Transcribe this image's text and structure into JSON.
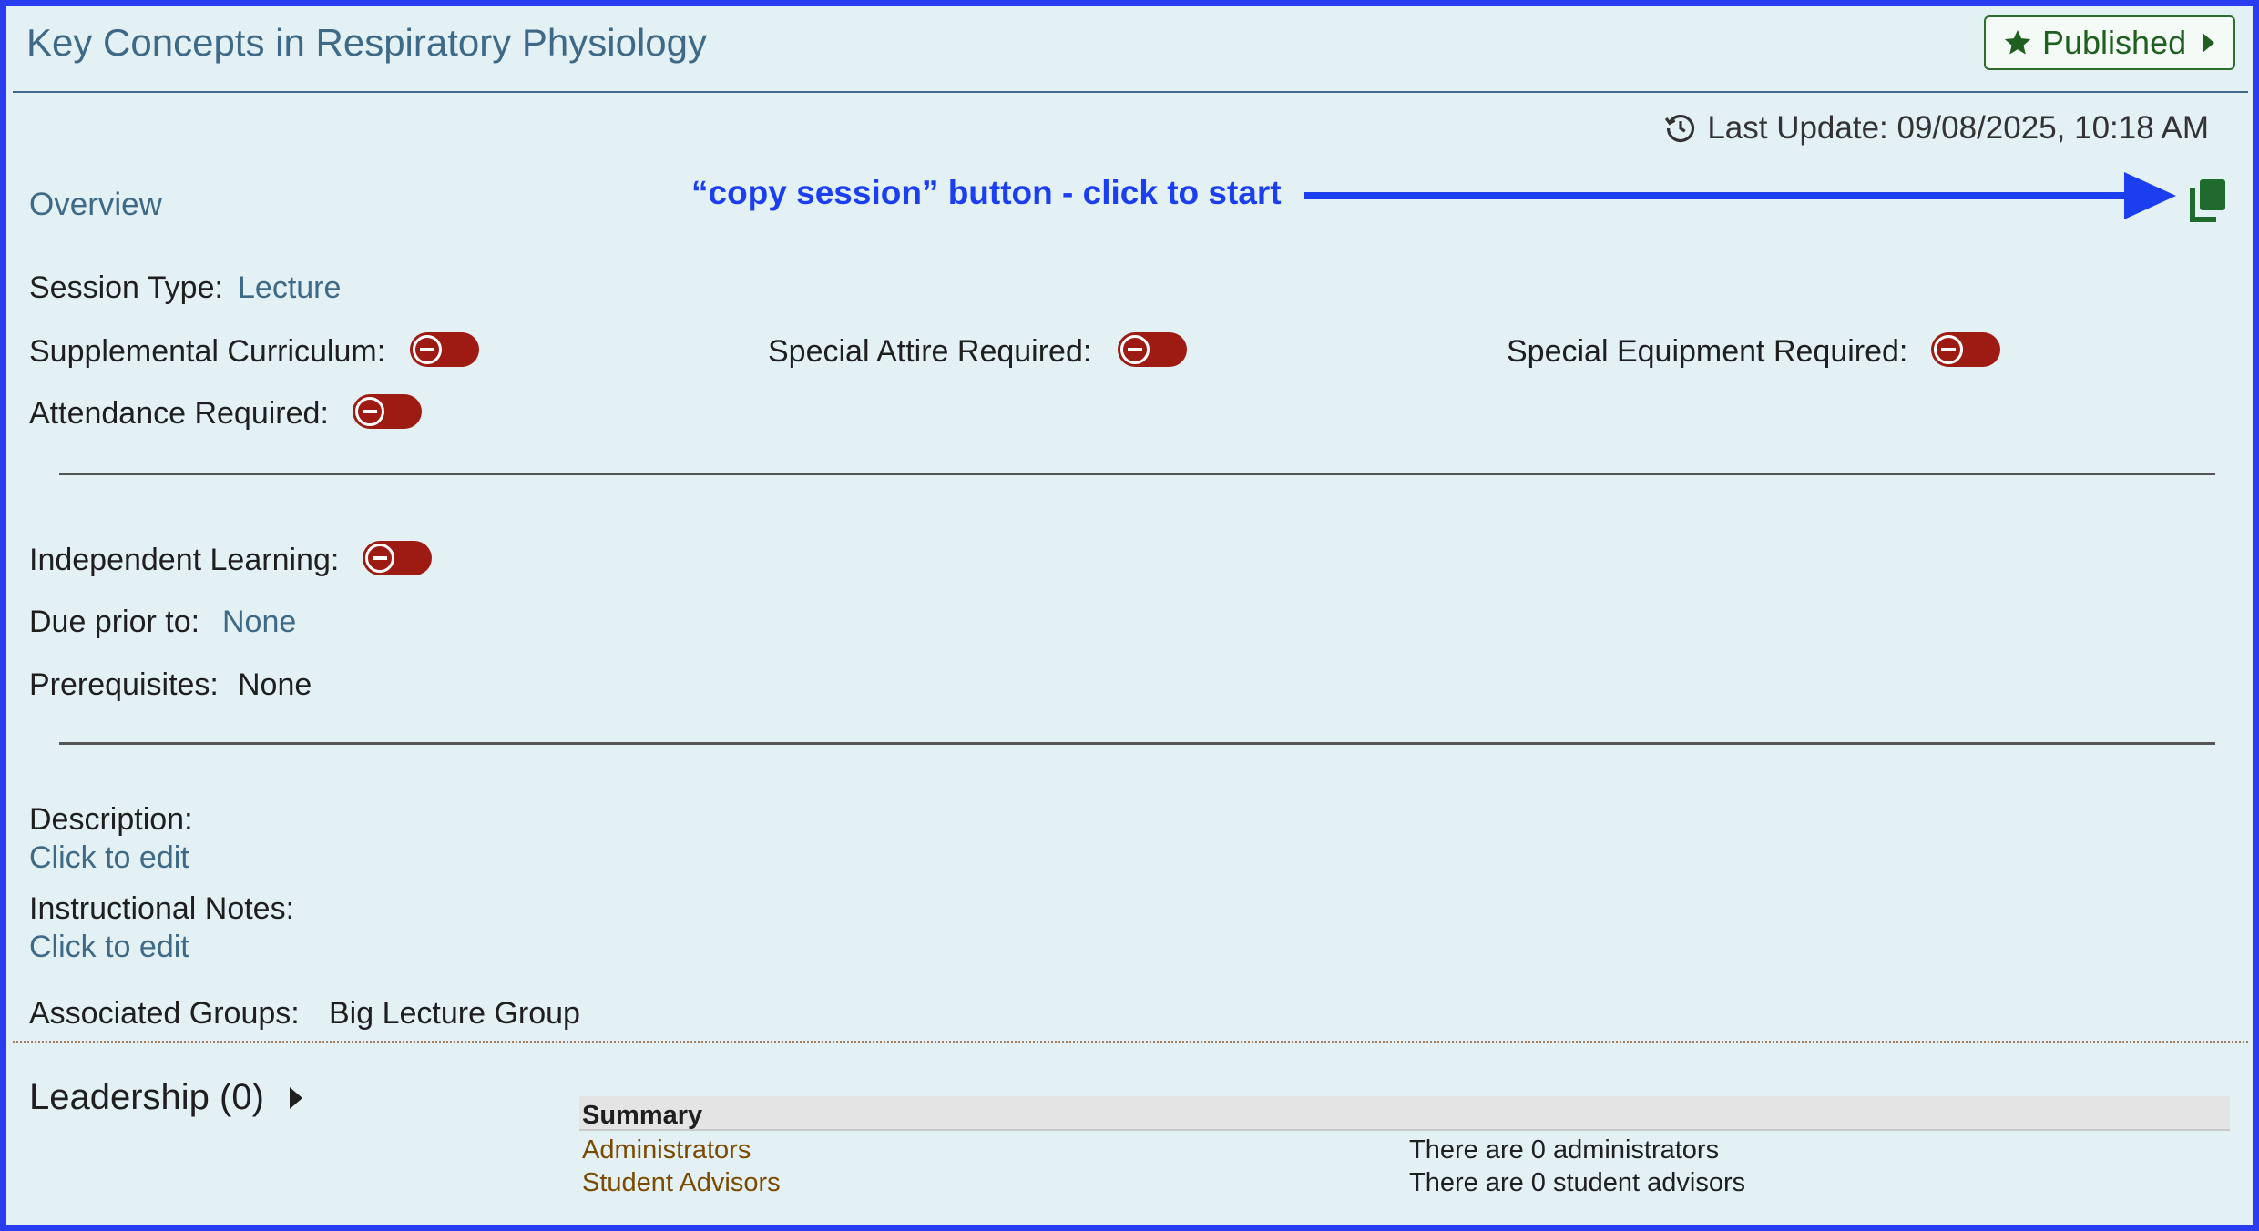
{
  "header": {
    "title": "Key Concepts in Respiratory Physiology",
    "status_button": "Published"
  },
  "meta": {
    "last_update": "Last Update: 09/08/2025, 10:18 AM"
  },
  "overview_label": "Overview",
  "annotation": {
    "text": "“copy session” button - click to start",
    "color": "#1b3ff0"
  },
  "fields": {
    "session_type_label": "Session Type:",
    "session_type_value": "Lecture",
    "supplemental_label": "Supplemental Curriculum:",
    "special_attire_label": "Special Attire Required:",
    "special_equipment_label": "Special Equipment Required:",
    "attendance_label": "Attendance Required:",
    "independent_label": "Independent Learning:",
    "due_prior_label": "Due prior to:",
    "due_prior_value": "None",
    "prereq_label": "Prerequisites:",
    "prereq_value": "None",
    "description_label": "Description:",
    "description_value": "Click to edit",
    "notes_label": "Instructional Notes:",
    "notes_value": "Click to edit",
    "groups_label": "Associated Groups:",
    "groups_value": "Big Lecture Group"
  },
  "toggles": {
    "supplemental": false,
    "special_attire": false,
    "special_equipment": false,
    "attendance": false,
    "independent": false
  },
  "leadership": {
    "title": "Leadership (0)",
    "summary_header": "Summary",
    "rows": [
      {
        "label": "Administrators",
        "text": "There are 0 administrators"
      },
      {
        "label": "Student Advisors",
        "text": "There are 0 student advisors"
      }
    ]
  },
  "colors": {
    "frame": "#2a3cf0",
    "background": "#e3f0f4",
    "accent": "#3e6a87",
    "toggle_off": "#9e1b14",
    "published": "#1f5f1f"
  },
  "icons": [
    "star-icon",
    "history-icon",
    "copy-icon",
    "caret-right-icon",
    "minus-circle-icon"
  ]
}
